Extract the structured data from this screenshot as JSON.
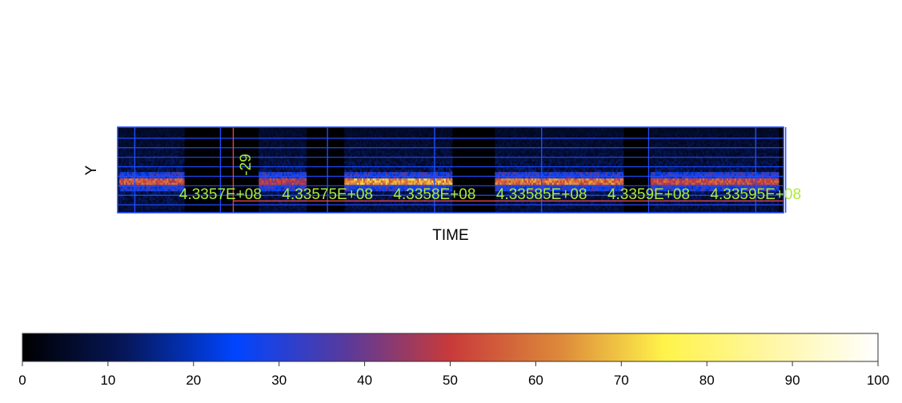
{
  "chart_data": {
    "type": "heatmap",
    "xlabel": "TIME",
    "ylabel": "Y",
    "x_tick_labels": [
      "4.3357E+08",
      "4.33575E+08",
      "4.3358E+08",
      "4.33585E+08",
      "4.3359E+08",
      "4.33595E+08"
    ],
    "y_tick_labels": [
      "-29"
    ],
    "x_ticks": [
      433570000,
      433575000,
      433580000,
      433585000,
      433590000,
      433595000
    ],
    "y_ticks": [
      -29
    ],
    "xlim": [
      433565200,
      433596300
    ],
    "ylim": [
      -29.5,
      -24
    ],
    "grid": true,
    "label_color": "#a8ee3a",
    "grid_color": "#1f4cff",
    "marker_color": "#e0474c",
    "marker_x": 433570600,
    "marker_y": -29,
    "observation_segments": [
      {
        "start": 433565300,
        "end": 433568300,
        "peak": 62
      },
      {
        "start": 433571800,
        "end": 433574000,
        "peak": 55
      },
      {
        "start": 433575800,
        "end": 433580800,
        "peak": 74
      },
      {
        "start": 433582800,
        "end": 433588800,
        "peak": 68
      },
      {
        "start": 433590100,
        "end": 433596100,
        "peak": 60
      }
    ],
    "source_row_y": -27.5,
    "colorbar": {
      "min": 0,
      "max": 100,
      "tick_labels": [
        "0",
        "10",
        "20",
        "30",
        "40",
        "50",
        "60",
        "70",
        "80",
        "90",
        "100"
      ],
      "ticks": [
        0,
        10,
        20,
        30,
        40,
        50,
        60,
        70,
        80,
        90,
        100
      ],
      "colormap": [
        {
          "v": 0,
          "c": "#000000"
        },
        {
          "v": 12,
          "c": "#06175a"
        },
        {
          "v": 25,
          "c": "#0045ff"
        },
        {
          "v": 38,
          "c": "#5a3a9a"
        },
        {
          "v": 50,
          "c": "#c83a3a"
        },
        {
          "v": 63,
          "c": "#dd8a3a"
        },
        {
          "v": 75,
          "c": "#fff34a"
        },
        {
          "v": 88,
          "c": "#fff7a8"
        },
        {
          "v": 100,
          "c": "#ffffff"
        }
      ]
    }
  }
}
